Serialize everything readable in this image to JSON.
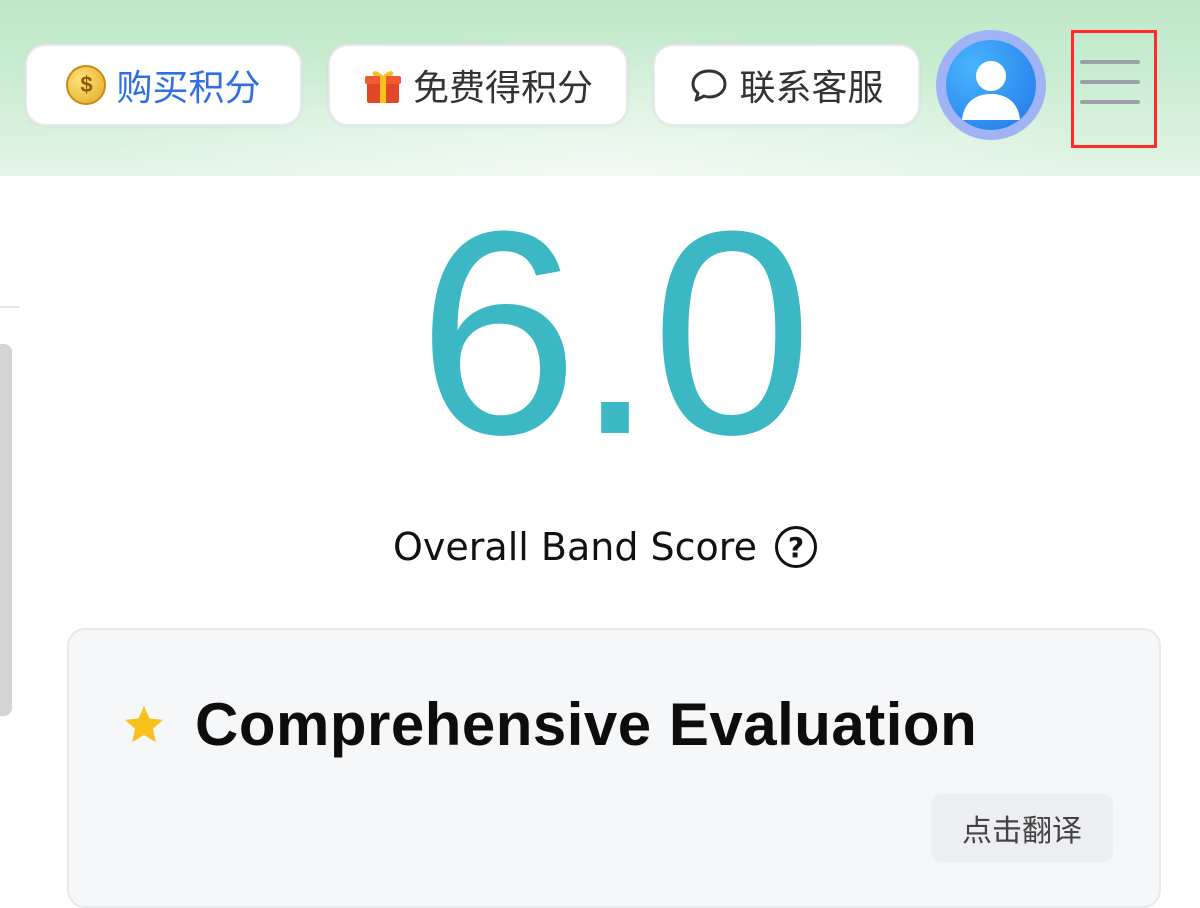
{
  "header": {
    "buy_points": {
      "label": "购买积分",
      "icon": "coin-icon"
    },
    "free_points": {
      "label": "免费得积分",
      "icon": "gift-icon"
    },
    "contact_support": {
      "label": "联系客服",
      "icon": "chat-bubble-icon"
    },
    "avatar": {
      "icon": "user-avatar-icon"
    },
    "menu": {
      "icon": "hamburger-menu-icon",
      "highlight_color": "#ff2b2b"
    }
  },
  "score": {
    "value": "6.0",
    "label": "Overall Band Score",
    "help_icon": "help-circle-icon",
    "color": "#3bb8c3"
  },
  "evaluation": {
    "title": "Comprehensive Evaluation",
    "icon": "star-icon",
    "translate_label": "点击翻译"
  },
  "accent": {
    "link_blue": "#2f6fe6",
    "star_yellow": "#f7c21b"
  }
}
